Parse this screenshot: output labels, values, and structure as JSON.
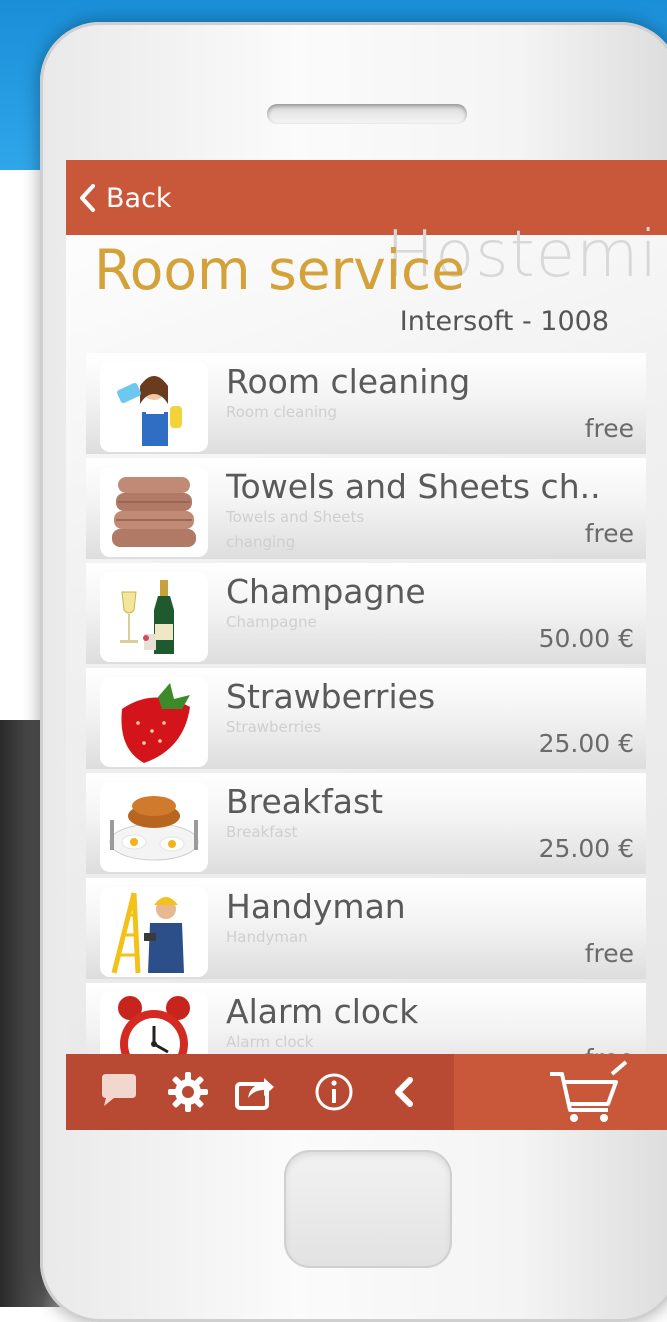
{
  "app": {
    "back_label": "Back",
    "title": "Room service",
    "watermark": "Hostemi",
    "subtitle": "Intersoft - 1008"
  },
  "items": [
    {
      "title": "Room cleaning",
      "subtitle": "Room cleaning",
      "price": "free",
      "icon": "cleaning-maid-icon"
    },
    {
      "title": "Towels and Sheets ch..",
      "subtitle": "Towels and Sheets changing",
      "price": "free",
      "icon": "towels-icon"
    },
    {
      "title": "Champagne",
      "subtitle": "Champagne",
      "price": "50.00 €",
      "icon": "champagne-icon"
    },
    {
      "title": "Strawberries",
      "subtitle": "Strawberries",
      "price": "25.00 €",
      "icon": "strawberry-icon"
    },
    {
      "title": "Breakfast",
      "subtitle": "Breakfast",
      "price": "25.00 €",
      "icon": "breakfast-icon"
    },
    {
      "title": "Handyman",
      "subtitle": "Handyman",
      "price": "free",
      "icon": "handyman-icon"
    },
    {
      "title": "Alarm clock",
      "subtitle": "Alarm clock",
      "price": "free",
      "icon": "alarm-clock-icon"
    }
  ],
  "bottom_bar": {
    "icons": [
      "chat-icon",
      "gear-icon",
      "share-icon",
      "info-icon",
      "chevron-left-icon",
      "cart-icon"
    ]
  },
  "colors": {
    "accent": "#c9583b",
    "accent_dark": "#b84a33",
    "title_gold": "#d4a23a"
  }
}
